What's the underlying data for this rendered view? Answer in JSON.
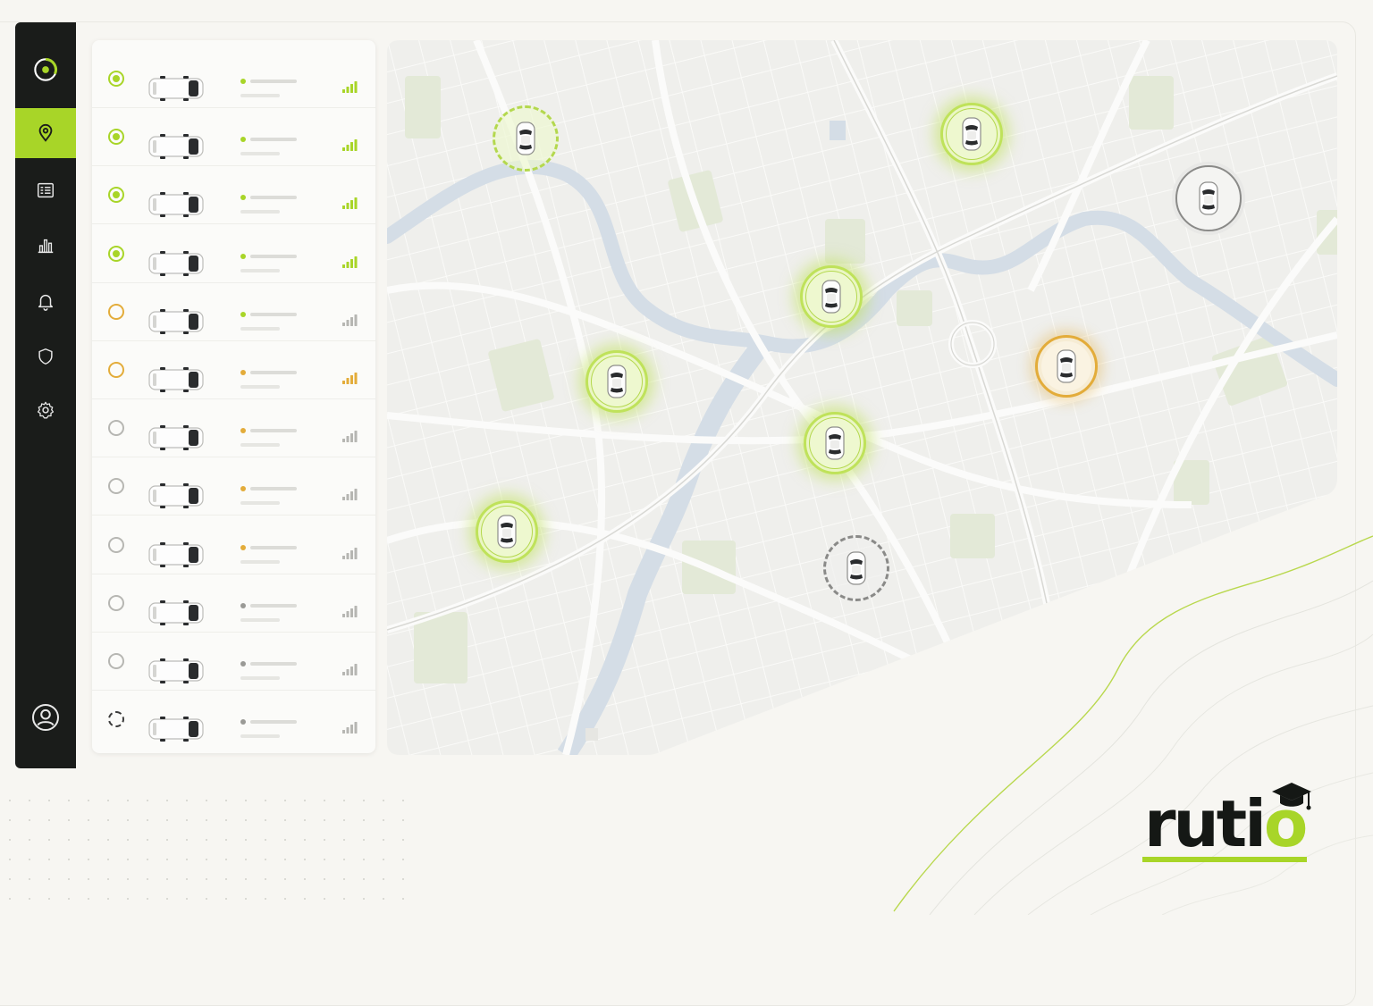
{
  "brand": {
    "logo_main": "rut",
    "logo_i": "i",
    "logo_o": "o",
    "accent": "#a8d528"
  },
  "sidebar": {
    "items": [
      {
        "icon": "logo-target-icon",
        "active": false
      },
      {
        "icon": "location-pin-icon",
        "active": true
      },
      {
        "icon": "list-report-icon",
        "active": false
      },
      {
        "icon": "bar-chart-icon",
        "active": false
      },
      {
        "icon": "bell-icon",
        "active": false
      },
      {
        "icon": "shield-icon",
        "active": false
      },
      {
        "icon": "gear-icon",
        "active": false
      }
    ],
    "footer_icon": "user-profile-icon"
  },
  "vehicles": [
    {
      "status": "online",
      "dot": "#a8d528",
      "signal_color": "#a8d528",
      "signal_level": 4
    },
    {
      "status": "online",
      "dot": "#a8d528",
      "signal_color": "#a8d528",
      "signal_level": 4
    },
    {
      "status": "online",
      "dot": "#a8d528",
      "signal_color": "#a8d528",
      "signal_level": 4
    },
    {
      "status": "online",
      "dot": "#a8d528",
      "signal_color": "#a8d528",
      "signal_level": 4
    },
    {
      "status": "idle",
      "dot": "#a8d528",
      "signal_color": "#b6b6b2",
      "signal_level": 4
    },
    {
      "status": "idle",
      "dot": "#e3ac3a",
      "signal_color": "#e3ac3a",
      "signal_level": 4
    },
    {
      "status": "offline",
      "dot": "#e3ac3a",
      "signal_color": "#b6b6b2",
      "signal_level": 4
    },
    {
      "status": "offline",
      "dot": "#e3ac3a",
      "signal_color": "#b6b6b2",
      "signal_level": 4
    },
    {
      "status": "offline",
      "dot": "#e3ac3a",
      "signal_color": "#b6b6b2",
      "signal_level": 4
    },
    {
      "status": "offline",
      "dot": "#9a9a96",
      "signal_color": "#b6b6b2",
      "signal_level": 4
    },
    {
      "status": "offline",
      "dot": "#9a9a96",
      "signal_color": "#b6b6b2",
      "signal_level": 4
    },
    {
      "status": "syncing",
      "dot": "#9a9a96",
      "signal_color": "#b6b6b2",
      "signal_level": 4
    }
  ],
  "map_markers": [
    {
      "state": "pending"
    },
    {
      "state": "live"
    },
    {
      "state": "grey"
    },
    {
      "state": "live"
    },
    {
      "state": "live"
    },
    {
      "state": "amber"
    },
    {
      "state": "live"
    },
    {
      "state": "live"
    },
    {
      "state": "grey-dashed"
    }
  ]
}
